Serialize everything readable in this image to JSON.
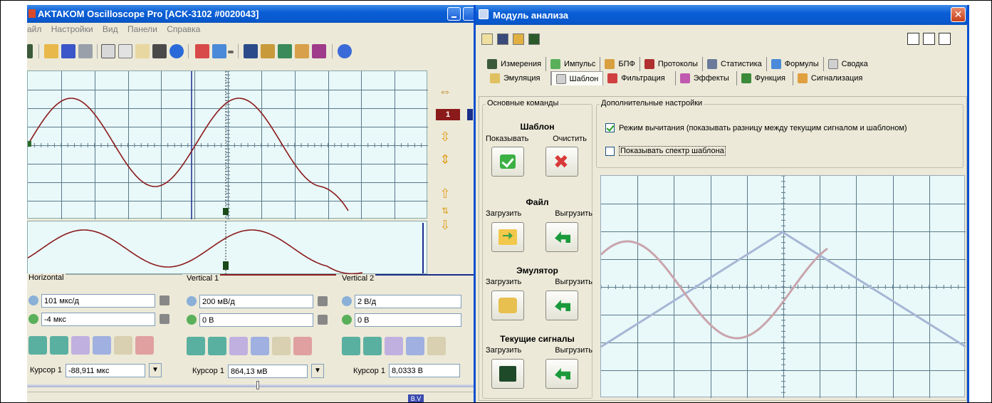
{
  "osc_window": {
    "title": "AKTAKOM Oscilloscope Pro [ACK-3102 #0020043]",
    "menu": [
      "айл",
      "Настройки",
      "Вид",
      "Панели",
      "Справка"
    ],
    "channel_marker": "1",
    "horizontal": {
      "label": "Horizontal",
      "timebase": "101 мкс/д",
      "offset": "-4 мкс",
      "cursor_label": "Курсор 1",
      "cursor_value": "-88,911 мкс"
    },
    "vertical1": {
      "label": "Vertical 1",
      "scale": "200 мВ/д",
      "offset": "0 В",
      "cursor_label": "Курсор 1",
      "cursor_value": "864,13 мВ"
    },
    "vertical2": {
      "label": "Vertical 2",
      "scale": "2 В/д",
      "offset": "0 В",
      "cursor_label": "Курсор 1",
      "cursor_value": "8,0333 В"
    },
    "status_badge": "B.V"
  },
  "module_window": {
    "title": "Модуль анализа",
    "close_glyph": "✕",
    "tabs_row1": [
      "Измерения",
      "Импульс",
      "БПФ",
      "Протоколы",
      "Статистика",
      "Формулы",
      "Сводка"
    ],
    "tabs_row2": [
      "Эмуляция",
      "Шаблон",
      "Фильтрация",
      "Эффекты",
      "Функция",
      "Сигнализация"
    ],
    "active_tab": "Шаблон",
    "basic_group_title": "Основные команды",
    "template": {
      "title": "Шаблон",
      "show_label": "Показывать",
      "clear_label": "Очистить"
    },
    "file": {
      "title": "Файл",
      "load_label": "Загрузить",
      "save_label": "Выгрузить"
    },
    "emulator": {
      "title": "Эмулятор",
      "load_label": "Загрузить",
      "save_label": "Выгрузить"
    },
    "current": {
      "title": "Текущие сигналы",
      "load_label": "Загрузить",
      "save_label": "Выгрузить"
    },
    "addl_group_title": "Дополнительные настройки",
    "subtract_mode_label": "Режим вычитания (показывать разницу между текущим сигналом и шаблоном)",
    "subtract_mode_checked": true,
    "show_spectrum_label": "Показывать спектр шаблона",
    "show_spectrum_checked": false
  },
  "colors": {
    "signal_red": "#8b1a1a",
    "signal_blue": "#1a2d8b",
    "template_pink": "#c9a4ac",
    "template_blue": "#a6b6d4",
    "grid": "#5a7a8a",
    "screen_bg": "#e9f8f9"
  }
}
